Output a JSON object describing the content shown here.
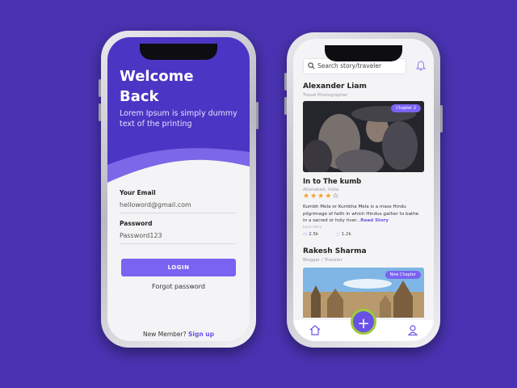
{
  "login_screen": {
    "welcome_title": "Welcome Back",
    "hero_subtitle": "Lorem Ipsum is simply dummy text of the printing",
    "email_label": "Your Email",
    "email_value": "helloword@gmail.com",
    "password_label": "Password",
    "password_value": "Password123",
    "login_button": "LOGIN",
    "forgot_password": "Forgot password",
    "member_prompt": "New Member?",
    "signup_link": "Sign up"
  },
  "feed_screen": {
    "search_placeholder": "Search story/traveler",
    "posts": [
      {
        "author": "Alexander Liam",
        "role": "Travel Photographer",
        "chip": "Chapter 2",
        "title": "In to The kumb",
        "location": "Allahabad, India",
        "rating": 4,
        "rating_max": 5,
        "description": "Kumbh Mela or Kumbha Mela is a mass Hindu pilgrimage of faith in which Hindus gather to bathe in a sacred or holy river...",
        "read_more": "Read Story",
        "caption": "Love story",
        "likes": "2.5k",
        "comments": "1.2k"
      },
      {
        "author": "Rakesh Sharma",
        "role": "Blogger / Traveler",
        "chip": "New Chapter"
      }
    ],
    "fab_symbol": "+",
    "nav_icons": [
      "home-icon",
      "add-icon",
      "profile-icon"
    ]
  },
  "colors": {
    "background": "#4a33b3",
    "hero": "#4b35c4",
    "accent": "#7a63f2",
    "star": "#f0a22b"
  }
}
